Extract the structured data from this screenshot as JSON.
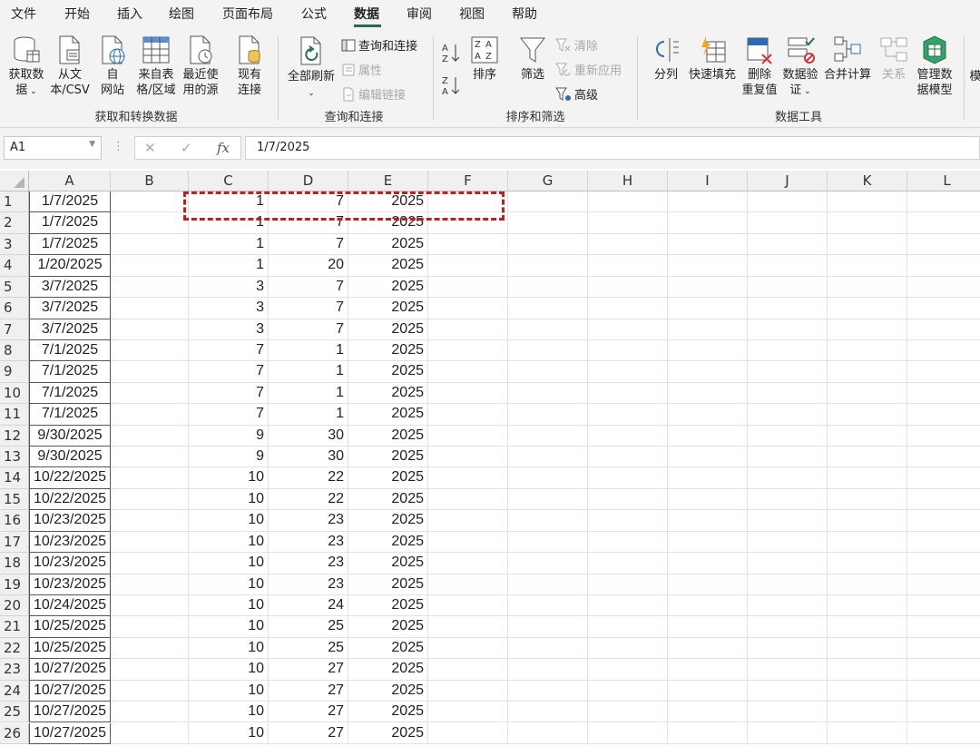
{
  "menu": {
    "tabs": [
      "文件",
      "开始",
      "插入",
      "绘图",
      "页面布局",
      "公式",
      "数据",
      "审阅",
      "视图",
      "帮助"
    ],
    "active_tab": "数据"
  },
  "ribbon": {
    "get_data_label_1": "获取数",
    "get_data_label_2": "据",
    "from_text_label_1": "从文",
    "from_text_label_2": "本/CSV",
    "from_web_label_1": "自",
    "from_web_label_2": "网站",
    "from_table_label_1": "来自表",
    "from_table_label_2": "格/区域",
    "recent_sources_label_1": "最近使",
    "recent_sources_label_2": "用的源",
    "existing_conn_label_1": "现有",
    "existing_conn_label_2": "连接",
    "group1_label": "获取和转换数据",
    "refresh_all_label": "全部刷新",
    "queries_conn_label": "查询和连接",
    "properties_label": "属性",
    "edit_links_label": "编辑链接",
    "group2_label": "查询和连接",
    "sort_label": "排序",
    "filter_label": "筛选",
    "clear_label": "清除",
    "reapply_label": "重新应用",
    "advanced_label": "高级",
    "group3_label": "排序和筛选",
    "split_label": "分列",
    "flash_fill_label": "快速填充",
    "remove_dup_label_1": "删除",
    "remove_dup_label_2": "重复值",
    "validation_label_1": "数据验",
    "validation_label_2": "证",
    "consolidate_label": "合并计算",
    "relations_label": "关系",
    "data_model_label_1": "管理数",
    "data_model_label_2": "据模型",
    "group4_label": "数据工具",
    "overflow_label": "模"
  },
  "formula_bar": {
    "name_box": "A1",
    "formula": "1/7/2025"
  },
  "columns": [
    "A",
    "B",
    "C",
    "D",
    "E",
    "F",
    "G",
    "H",
    "I",
    "J",
    "K",
    "L"
  ],
  "rows": [
    {
      "n": "1",
      "A": "1/7/2025",
      "C": "1",
      "D": "7",
      "E": "2025"
    },
    {
      "n": "2",
      "A": "1/7/2025",
      "C": "1",
      "D": "7",
      "E": "2025"
    },
    {
      "n": "3",
      "A": "1/7/2025",
      "C": "1",
      "D": "7",
      "E": "2025"
    },
    {
      "n": "4",
      "A": "1/20/2025",
      "C": "1",
      "D": "20",
      "E": "2025"
    },
    {
      "n": "5",
      "A": "3/7/2025",
      "C": "3",
      "D": "7",
      "E": "2025"
    },
    {
      "n": "6",
      "A": "3/7/2025",
      "C": "3",
      "D": "7",
      "E": "2025"
    },
    {
      "n": "7",
      "A": "3/7/2025",
      "C": "3",
      "D": "7",
      "E": "2025"
    },
    {
      "n": "8",
      "A": "7/1/2025",
      "C": "7",
      "D": "1",
      "E": "2025"
    },
    {
      "n": "9",
      "A": "7/1/2025",
      "C": "7",
      "D": "1",
      "E": "2025"
    },
    {
      "n": "10",
      "A": "7/1/2025",
      "C": "7",
      "D": "1",
      "E": "2025"
    },
    {
      "n": "11",
      "A": "7/1/2025",
      "C": "7",
      "D": "1",
      "E": "2025"
    },
    {
      "n": "12",
      "A": "9/30/2025",
      "C": "9",
      "D": "30",
      "E": "2025"
    },
    {
      "n": "13",
      "A": "9/30/2025",
      "C": "9",
      "D": "30",
      "E": "2025"
    },
    {
      "n": "14",
      "A": "10/22/2025",
      "C": "10",
      "D": "22",
      "E": "2025"
    },
    {
      "n": "15",
      "A": "10/22/2025",
      "C": "10",
      "D": "22",
      "E": "2025"
    },
    {
      "n": "16",
      "A": "10/23/2025",
      "C": "10",
      "D": "23",
      "E": "2025"
    },
    {
      "n": "17",
      "A": "10/23/2025",
      "C": "10",
      "D": "23",
      "E": "2025"
    },
    {
      "n": "18",
      "A": "10/23/2025",
      "C": "10",
      "D": "23",
      "E": "2025"
    },
    {
      "n": "19",
      "A": "10/23/2025",
      "C": "10",
      "D": "23",
      "E": "2025"
    },
    {
      "n": "20",
      "A": "10/24/2025",
      "C": "10",
      "D": "24",
      "E": "2025"
    },
    {
      "n": "21",
      "A": "10/25/2025",
      "C": "10",
      "D": "25",
      "E": "2025"
    },
    {
      "n": "22",
      "A": "10/25/2025",
      "C": "10",
      "D": "25",
      "E": "2025"
    },
    {
      "n": "23",
      "A": "10/27/2025",
      "C": "10",
      "D": "27",
      "E": "2025"
    },
    {
      "n": "24",
      "A": "10/27/2025",
      "C": "10",
      "D": "27",
      "E": "2025"
    },
    {
      "n": "25",
      "A": "10/27/2025",
      "C": "10",
      "D": "27",
      "E": "2025"
    },
    {
      "n": "26",
      "A": "10/27/2025",
      "C": "10",
      "D": "27",
      "E": "2025"
    }
  ],
  "colors": {
    "accent_green": "#1e7145",
    "highlight_red": "#c0201d"
  }
}
